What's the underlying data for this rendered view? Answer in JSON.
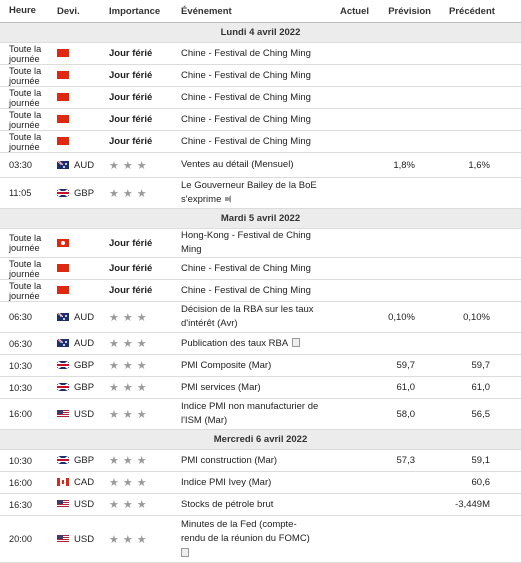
{
  "headers": {
    "time": "Heure",
    "currency": "Devi.",
    "importance": "Importance",
    "event": "Événement",
    "actual": "Actuel",
    "forecast": "Prévision",
    "previous": "Précédent"
  },
  "dates": {
    "d1": "Lundi 4 avril 2022",
    "d2": "Mardi 5 avril 2022",
    "d3": "Mercredi 6 avril 2022"
  },
  "holiday_label": "Jour férié",
  "allday_line1": "Toute la",
  "allday_line2": "journée",
  "stars": "★★★",
  "rows": [
    {
      "event": "Chine - Festival de Ching Ming"
    },
    {
      "event": "Chine - Festival de Ching Ming"
    },
    {
      "event": "Chine - Festival de Ching Ming"
    },
    {
      "event": "Chine - Festival de Ching Ming"
    },
    {
      "event": "Chine - Festival de Ching Ming"
    },
    {
      "time": "03:30",
      "cur": "AUD",
      "event": "Ventes au détail (Mensuel)",
      "forecast": "1,8%",
      "previous": "1,6%"
    },
    {
      "time": "11:05",
      "cur": "GBP",
      "event1": "Le Gouverneur Bailey de la BoE",
      "event2": "s'exprime"
    },
    {
      "event": "Hong-Kong - Festival de Ching Ming"
    },
    {
      "event": "Chine - Festival de Ching Ming"
    },
    {
      "event": "Chine - Festival de Ching Ming"
    },
    {
      "time": "06:30",
      "cur": "AUD",
      "event1": "Décision de la RBA sur les taux",
      "event2": "d'intérêt (Avr)",
      "forecast": "0,10%",
      "previous": "0,10%"
    },
    {
      "time": "06:30",
      "cur": "AUD",
      "event": "Publication des taux RBA"
    },
    {
      "time": "10:30",
      "cur": "GBP",
      "event": "PMI Composite (Mar)",
      "forecast": "59,7",
      "previous": "59,7"
    },
    {
      "time": "10:30",
      "cur": "GBP",
      "event": "PMI services (Mar)",
      "forecast": "61,0",
      "previous": "61,0"
    },
    {
      "time": "16:00",
      "cur": "USD",
      "event1": "Indice PMI non manufacturier de",
      "event2": "l'ISM (Mar)",
      "forecast": "58,0",
      "previous": "56,5"
    },
    {
      "time": "10:30",
      "cur": "GBP",
      "event": "PMI construction (Mar)",
      "forecast": "57,3",
      "previous": "59,1"
    },
    {
      "time": "16:00",
      "cur": "CAD",
      "event": "Indice PMI Ivey (Mar)",
      "previous": "60,6"
    },
    {
      "time": "16:30",
      "cur": "USD",
      "event": "Stocks de pétrole brut",
      "previous": "-3,449M"
    },
    {
      "time": "20:00",
      "cur": "USD",
      "event1": "Minutes de la Fed (compte-",
      "event2": "rendu de la réunion du FOMC)"
    }
  ]
}
